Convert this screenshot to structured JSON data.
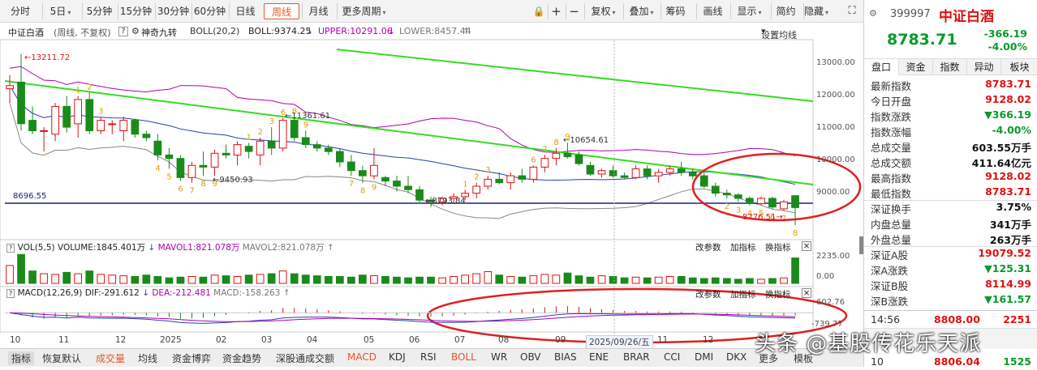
{
  "toolbar": {
    "periods": [
      "分时",
      "5日",
      "5分钟",
      "15分钟",
      "30分钟",
      "60分钟",
      "日线",
      "周线",
      "月线",
      "更多周期"
    ],
    "active_period": "周线",
    "tools": [
      "复权",
      "叠加",
      "筹码",
      "画线",
      "显示",
      "简约",
      "隐藏"
    ]
  },
  "chart_header": {
    "name": "中证白酒",
    "mode": "(周线, 不复权)",
    "indicator": "神奇九转",
    "boll": "BOLL(20,2)",
    "boll_mid": "BOLL:9374.25",
    "boll_upper": "UPPER:10291.06",
    "boll_lower": "LOWER:8457.44",
    "set_ma": "设置均线"
  },
  "price_axis": [
    "13000.00",
    "12000.00",
    "11000.00",
    "10000.00",
    "9000.00"
  ],
  "annotations": {
    "high": "13211.72",
    "p1": "9450.93",
    "p2": "11361.61",
    "p3": "8793.84",
    "p4": "10654.61",
    "p5": "8276.51",
    "hline": "8696.55"
  },
  "volume_header": {
    "name": "VOL(5,5)",
    "volume": "VOLUME:1845.401万",
    "mavol1": "MAVOL1:821.078万",
    "mavol2": "MAVOL2:821.078万",
    "actions": [
      "改参数",
      "加指标",
      "换指标"
    ],
    "axis": [
      "2235.00",
      "0.00"
    ]
  },
  "macd_header": {
    "name": "MACD(12,26,9)",
    "dif": "DIF:-291.612",
    "dea": "DEA:-212.481",
    "macd": "MACD:-158.263",
    "actions": [
      "改参数",
      "加指标",
      "换指标"
    ],
    "axis": [
      "602.76",
      "-739.77"
    ]
  },
  "x_axis": [
    "10",
    "11",
    "12",
    "2025",
    "02",
    "03",
    "04",
    "05",
    "06",
    "07",
    "08",
    "09",
    "2025/09/26/五",
    "11",
    "12"
  ],
  "right_panel": {
    "code": "399997",
    "name": "中证白酒",
    "price": "8783.71",
    "change": "-366.19",
    "change_pct": "-4.00%",
    "tabs": [
      "盘口",
      "资金",
      "指数",
      "异动",
      "板块"
    ],
    "rows": [
      {
        "k": "最新指数",
        "v": "8783.71",
        "c": "red"
      },
      {
        "k": "今日开盘",
        "v": "9128.02",
        "c": "red"
      },
      {
        "k": "指数涨跌",
        "v": "▼366.19",
        "c": "green"
      },
      {
        "k": "指数涨幅",
        "v": "-4.00%",
        "c": "green"
      },
      {
        "k": "总成交量",
        "v": "603.55万手",
        "c": "blk"
      },
      {
        "k": "总成交额",
        "v": "411.64亿元",
        "c": "blk"
      },
      {
        "k": "最高指数",
        "v": "9128.02",
        "c": "red"
      },
      {
        "k": "最低指数",
        "v": "8783.71",
        "c": "red"
      },
      {
        "k": "深证换手",
        "v": "3.75%",
        "c": "blk"
      },
      {
        "k": "内盘总量",
        "v": "341万手",
        "c": "blk"
      },
      {
        "k": "外盘总量",
        "v": "263万手",
        "c": "blk"
      },
      {
        "k": "深证A股",
        "v": "19079.52",
        "c": "red"
      },
      {
        "k": "深A涨跌",
        "v": "▼125.31",
        "c": "green"
      },
      {
        "k": "深证B股",
        "v": "8114.99",
        "c": "red"
      },
      {
        "k": "深B涨跌",
        "v": "▼161.57",
        "c": "green"
      }
    ],
    "ticks": [
      {
        "t": "14:56",
        "p": "8808.00",
        "v": "2251"
      },
      {
        "t": "10",
        "p": "8806.04",
        "v": "1525"
      }
    ]
  },
  "bottom_tabs": [
    "指标",
    "恢复默认",
    "成交量",
    "均线",
    "资金博弈",
    "资金趋势",
    "深股通成交额",
    "MACD",
    "KDJ",
    "RSI",
    "BOLL",
    "WR",
    "OBV",
    "BIAS",
    "ENE",
    "BRAR",
    "CCI",
    "DMI",
    "DKX",
    "更多",
    "模板"
  ],
  "watermark": "头条 @基股传花乐天派",
  "candles": [
    [
      12210,
      12600,
      11800,
      12300
    ],
    [
      12400,
      13212,
      11000,
      11200
    ],
    [
      11300,
      11700,
      10900,
      11000
    ],
    [
      11000,
      11100,
      10400,
      11000
    ],
    [
      10900,
      11800,
      10700,
      11700
    ],
    [
      11700,
      12000,
      10950,
      11100
    ],
    [
      11200,
      12000,
      10800,
      11900
    ],
    [
      11900,
      12100,
      10900,
      11000
    ],
    [
      11000,
      11400,
      10900,
      11300
    ],
    [
      11200,
      11300,
      10900,
      11200
    ],
    [
      11000,
      11400,
      10700,
      11300
    ],
    [
      11300,
      11350,
      10800,
      10900
    ],
    [
      10900,
      11000,
      10700,
      10800
    ],
    [
      10700,
      10900,
      10150,
      10300
    ],
    [
      10300,
      10500,
      9900,
      10200
    ],
    [
      10200,
      10300,
      9550,
      9650
    ],
    [
      9650,
      10100,
      9500,
      10000
    ],
    [
      10000,
      10400,
      9700,
      9950
    ],
    [
      9950,
      10450,
      9700,
      10350
    ],
    [
      10350,
      10600,
      10200,
      10300
    ],
    [
      10300,
      10700,
      10000,
      10600
    ],
    [
      10550,
      10650,
      10200,
      10400
    ],
    [
      10300,
      10800,
      10000,
      10700
    ],
    [
      10700,
      11100,
      10300,
      10500
    ],
    [
      10500,
      11361,
      10400,
      11300
    ],
    [
      11300,
      11400,
      10700,
      10800
    ],
    [
      10800,
      11000,
      10500,
      10600
    ],
    [
      10600,
      10700,
      10400,
      10500
    ],
    [
      10500,
      10600,
      10300,
      10400
    ],
    [
      10400,
      10500,
      9950,
      10100
    ],
    [
      10100,
      10300,
      9700,
      9850
    ],
    [
      9850,
      10000,
      9500,
      9700
    ],
    [
      9700,
      10500,
      9600,
      10000
    ],
    [
      9650,
      9700,
      9400,
      9550
    ],
    [
      9550,
      9700,
      9250,
      9400
    ],
    [
      9400,
      9700,
      9200,
      9300
    ],
    [
      9300,
      9400,
      8900,
      9000
    ],
    [
      9000,
      9100,
      8800,
      8950
    ],
    [
      8950,
      9100,
      8850,
      9050
    ],
    [
      9050,
      9200,
      8900,
      9100
    ],
    [
      9100,
      9300,
      9000,
      9200
    ],
    [
      9200,
      9500,
      9050,
      9400
    ],
    [
      9400,
      9700,
      9300,
      9600
    ],
    [
      9600,
      9800,
      9450,
      9500
    ],
    [
      9500,
      9800,
      9300,
      9700
    ],
    [
      9700,
      9900,
      9500,
      9600
    ],
    [
      9600,
      10000,
      9500,
      9950
    ],
    [
      9950,
      10300,
      9800,
      10200
    ],
    [
      10200,
      10500,
      10000,
      10350
    ],
    [
      10350,
      10655,
      10200,
      10250
    ],
    [
      10300,
      10400,
      10000,
      10050
    ],
    [
      10000,
      10100,
      9700,
      9750
    ],
    [
      9750,
      9900,
      9650,
      9850
    ],
    [
      9850,
      10000,
      9650,
      9700
    ],
    [
      9700,
      9800,
      9600,
      9650
    ],
    [
      9650,
      10000,
      9600,
      9900
    ],
    [
      9900,
      10000,
      9600,
      9700
    ],
    [
      9700,
      9900,
      9500,
      9800
    ],
    [
      9800,
      10000,
      9700,
      9900
    ],
    [
      9900,
      10100,
      9700,
      9800
    ],
    [
      9800,
      9900,
      9600,
      9700
    ],
    [
      9700,
      9800,
      9350,
      9400
    ],
    [
      9400,
      9500,
      9100,
      9200
    ],
    [
      9200,
      9300,
      9050,
      9150
    ],
    [
      9150,
      9200,
      8950,
      9050
    ],
    [
      9050,
      9100,
      8850,
      8900
    ],
    [
      8900,
      9100,
      8850,
      9050
    ],
    [
      9050,
      9100,
      8750,
      8800
    ],
    [
      8750,
      9000,
      8700,
      8950
    ],
    [
      9128,
      9128,
      8276,
      8784
    ]
  ],
  "volumes": [
    1300,
    2100,
    900,
    700,
    650,
    800,
    700,
    900,
    650,
    600,
    550,
    500,
    600,
    500,
    400,
    450,
    500,
    450,
    600,
    550,
    500,
    600,
    650,
    700,
    900,
    700,
    600,
    550,
    500,
    500,
    450,
    600,
    550,
    500,
    450,
    400,
    450,
    450,
    400,
    500,
    600,
    700,
    850,
    600,
    500,
    450,
    550,
    650,
    600,
    750,
    550,
    450,
    550,
    500,
    400,
    450,
    400,
    450,
    500,
    500,
    400,
    350,
    400,
    350,
    300,
    350,
    300,
    350,
    400,
    1845
  ],
  "nine_turn": [
    {
      "i": 13,
      "n": "4"
    },
    {
      "i": 14,
      "n": "5"
    },
    {
      "i": 15,
      "n": "6"
    },
    {
      "i": 16,
      "n": "7"
    },
    {
      "i": 17,
      "n": "8"
    },
    {
      "i": 18,
      "n": "9"
    },
    {
      "i": 30,
      "n": "7"
    },
    {
      "i": 31,
      "n": "8"
    },
    {
      "i": 32,
      "n": "9"
    },
    {
      "i": 63,
      "n": "2"
    },
    {
      "i": 64,
      "n": "3"
    },
    {
      "i": 65,
      "n": "4"
    },
    {
      "i": 66,
      "n": "5"
    },
    {
      "i": 67,
      "n": "6"
    },
    {
      "i": 68,
      "n": "7"
    },
    {
      "i": 69,
      "n": "8"
    }
  ],
  "nine_turn_up": [
    {
      "i": 6,
      "n": "1"
    },
    {
      "i": 7,
      "n": "2"
    },
    {
      "i": 8,
      "n": "3"
    },
    {
      "i": 21,
      "n": "1"
    },
    {
      "i": 22,
      "n": "2"
    },
    {
      "i": 23,
      "n": "3"
    },
    {
      "i": 24,
      "n": "6"
    },
    {
      "i": 25,
      "n": "8"
    },
    {
      "i": 26,
      "n": "9"
    },
    {
      "i": 40,
      "n": "1"
    },
    {
      "i": 41,
      "n": "2"
    },
    {
      "i": 42,
      "n": "3"
    },
    {
      "i": 46,
      "n": "6"
    },
    {
      "i": 47,
      "n": "7"
    },
    {
      "i": 48,
      "n": "8"
    },
    {
      "i": 49,
      "n": "9"
    }
  ]
}
